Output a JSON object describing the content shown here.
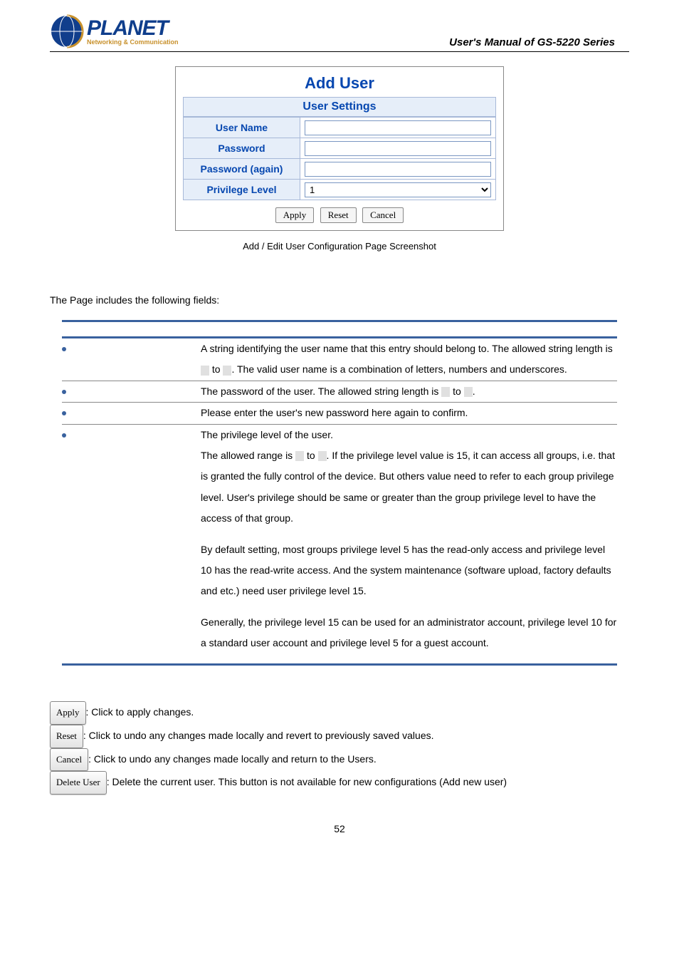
{
  "header": {
    "manual_title": "User's Manual of GS-5220 Series",
    "logo_main": "PLANET",
    "logo_sub": "Networking & Communication"
  },
  "form": {
    "title": "Add User",
    "section_header": "User Settings",
    "rows": {
      "username_label": "User Name",
      "password_label": "Password",
      "password_again_label": "Password (again)",
      "privilege_label": "Privilege Level",
      "privilege_value": "1"
    },
    "buttons": {
      "apply": "Apply",
      "reset": "Reset",
      "cancel": "Cancel"
    }
  },
  "caption": "Add / Edit User Configuration Page Screenshot",
  "fields_intro": "The Page includes the following fields:",
  "table_headers": {
    "left": "",
    "right": ""
  },
  "table": [
    {
      "label": "",
      "desc_parts": [
        "A string identifying the user name that this entry should belong to. The allowed string length is ",
        " to ",
        ". The valid user name is a combination of letters, numbers and underscores."
      ],
      "vals": [
        "",
        ""
      ]
    },
    {
      "label": "",
      "desc_parts": [
        "The password of the user. The allowed string length is ",
        " to ",
        "."
      ],
      "vals": [
        "",
        ""
      ]
    },
    {
      "label": "",
      "desc_parts": [
        "Please enter the user's new password here again to confirm."
      ],
      "vals": []
    },
    {
      "label": "",
      "desc_parts": [
        "The privilege level of the user."
      ],
      "paragraph2_parts": [
        "The allowed range is ",
        " to ",
        ". If the privilege level value is 15, it can access all groups, i.e. that is granted the fully control of the device. But others value need to refer to each group privilege level. User's privilege should be same or greater than the group privilege level to have the access of that group."
      ],
      "paragraph3": "By default setting, most groups privilege level 5 has the read-only access and privilege level 10 has the read-write access. And the system maintenance (software upload, factory defaults and etc.) need user privilege level 15.",
      "paragraph4": "Generally, the privilege level 15 can be used for an administrator account, privilege level 10 for a standard user account and privilege level 5 for a guest account.",
      "vals": [
        "",
        ""
      ]
    }
  ],
  "buttons_desc": {
    "heading": "",
    "apply": {
      "label": "Apply",
      "text": ": Click to apply changes."
    },
    "reset": {
      "label": "Reset",
      "text": ": Click to undo any changes made locally and revert to previously saved values."
    },
    "cancel": {
      "label": "Cancel",
      "text": ": Click to undo any changes made locally and return to the Users."
    },
    "delete": {
      "label": "Delete User",
      "text": ": Delete the current user. This button is not available for new configurations (Add new user)"
    }
  },
  "page_number": "52"
}
